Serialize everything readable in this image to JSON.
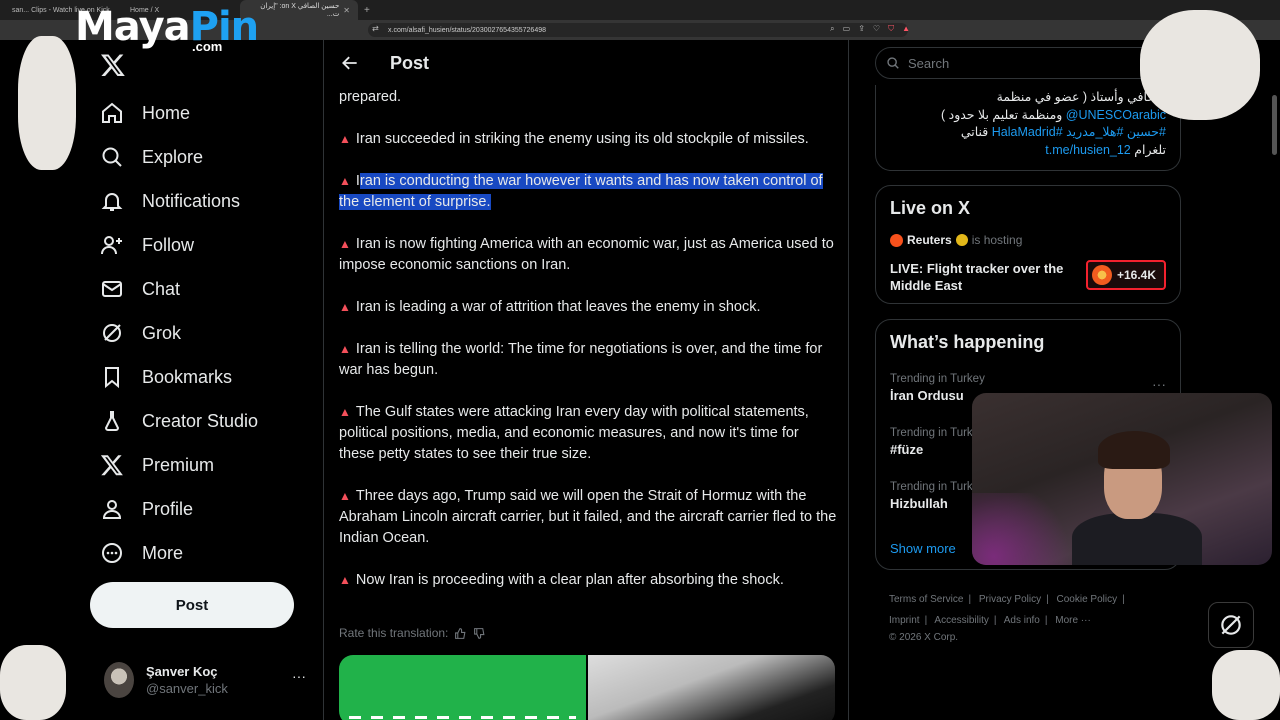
{
  "browser": {
    "tabs": [
      {
        "label": "san... Clips - Watch live on Kick",
        "active": false
      },
      {
        "label": "Home / X",
        "active": false
      },
      {
        "label": "حسين الصافي on X: \"إيران ت...",
        "active": true
      }
    ],
    "url": "x.com/alsafi_husien/status/2030027654355726498"
  },
  "overlay_logo": {
    "maya": "Maya",
    "pin": "Pin",
    "dotcom": ".com"
  },
  "nav": {
    "items": [
      {
        "label": "Home",
        "icon": "home-icon"
      },
      {
        "label": "Explore",
        "icon": "search-icon"
      },
      {
        "label": "Notifications",
        "icon": "bell-icon"
      },
      {
        "label": "Follow",
        "icon": "add-person-icon"
      },
      {
        "label": "Chat",
        "icon": "mail-icon"
      },
      {
        "label": "Grok",
        "icon": "grok-icon"
      },
      {
        "label": "Bookmarks",
        "icon": "bookmark-icon"
      },
      {
        "label": "Creator Studio",
        "icon": "flask-icon"
      },
      {
        "label": "Premium",
        "icon": "x-icon"
      },
      {
        "label": "Profile",
        "icon": "person-icon"
      },
      {
        "label": "More",
        "icon": "more-circle-icon"
      }
    ],
    "post_label": "Post",
    "profile": {
      "name": "Şanver Koç",
      "handle": "@sanver_kick",
      "more": "···"
    }
  },
  "main": {
    "header_title": "Post",
    "paragraphs": [
      {
        "bullet": false,
        "text": "prepared."
      },
      {
        "bullet": true,
        "text": "Iran succeeded in striking the enemy using its old stockpile of missiles."
      },
      {
        "bullet": true,
        "pre": "I",
        "highlight": "ran is conducting the war however it wants and has now taken control of the element of surprise."
      },
      {
        "bullet": true,
        "text": "Iran is now fighting America with an economic war, just as America used to impose economic sanctions on Iran."
      },
      {
        "bullet": true,
        "text": "Iran is leading a war of attrition that leaves the enemy in shock."
      },
      {
        "bullet": true,
        "text": "Iran is telling the world: The time for negotiations is over, and the time for war has begun."
      },
      {
        "bullet": true,
        "text": "The Gulf states were attacking Iran every day with political statements, political positions, media, and economic measures, and now it's time for these petty states to see their true size."
      },
      {
        "bullet": true,
        "text": "Three days ago, Trump said we will open the Strait of Hormuz with the Abraham Lincoln aircraft carrier, but it failed, and the aircraft carrier fled to the Indian Ocean."
      },
      {
        "bullet": true,
        "text": "Now Iran is proceeding with a clear plan after absorbing the shock."
      }
    ],
    "rate_label": "Rate this translation:"
  },
  "sidebar": {
    "search_placeholder": "Search",
    "bio": {
      "line1": "صحافي وأستاذ ( عضو في منظمة",
      "line2_link": "@UNESCOarabic",
      "line2_text": " ومنظمة تعليم بلا حدود )",
      "line3_links": "#حسين #هلا_مدريد #HalaMadrid",
      "line3_text": " قناتي",
      "line4_text": "تلغرام ",
      "line4_link": "t.me/husien_12"
    },
    "live": {
      "title": "Live on X",
      "host": "Reuters",
      "hosting": "is hosting",
      "stream_title": "LIVE: Flight tracker over the Middle East",
      "count": "+16.4K"
    },
    "happening": {
      "title": "What’s happening",
      "trends": [
        {
          "meta": "Trending in Turkey",
          "name": "İran Ordusu"
        },
        {
          "meta": "Trending in Turk",
          "name": "#füze"
        },
        {
          "meta": "Trending in Turk",
          "name": "Hizbullah"
        }
      ],
      "show_more": "Show more"
    },
    "footer": {
      "links": [
        "Terms of Service",
        "Privacy Policy",
        "Cookie Policy",
        "Imprint",
        "Accessibility",
        "Ads info",
        "More ···"
      ],
      "copyright": "© 2026 X Corp."
    }
  },
  "colors": {
    "accent": "#1d9bf0",
    "highlight": "#1849c2",
    "bullet": "#f4505b",
    "live_border": "#f4212e"
  }
}
